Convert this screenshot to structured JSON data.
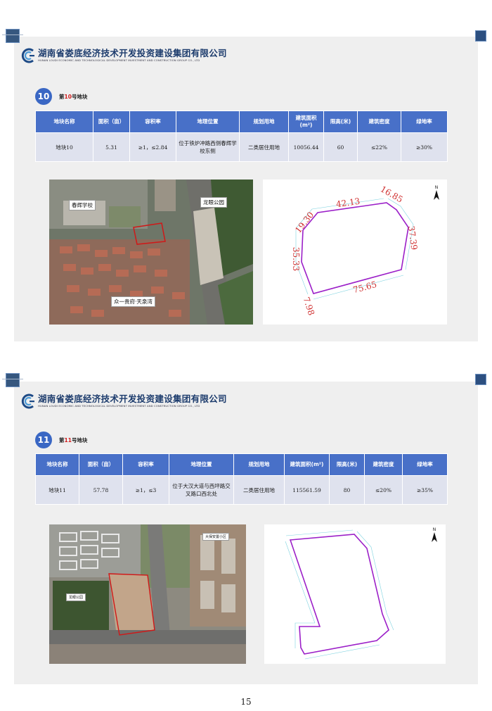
{
  "company": {
    "name_cn": "湖南省娄底经济技术开发投资建设集团有限公司",
    "name_en": "HUNAN LOUDI ECONOMIC AND TECHNOLOGICAL DEVELOPMENT INVESTMENT AND CONSTRUCTION GROUP CO., LTD"
  },
  "table_headers": {
    "name": "地块名称",
    "area": "面积（亩）",
    "far": "容积率",
    "location": "地理位置",
    "land_use": "规划用地",
    "floor_area": "建筑面积(m²)",
    "height": "限高(米)",
    "density": "建筑密度",
    "green": "绿地率"
  },
  "plots": [
    {
      "badge": "10",
      "heading_prefix": "第",
      "heading_num": "10",
      "heading_suffix": "号地块",
      "row": {
        "name": "地块10",
        "area": "5.31",
        "far": "≥1，≤2.84",
        "location": "位于铁炉冲路西侧春辉学校东侧",
        "land_use": "二类居住用地",
        "floor_area": "10056.44",
        "height": "60",
        "density": "≤22%",
        "green": "≥30%"
      },
      "map_labels": {
        "school": "春辉学校",
        "park": "龙眼公园",
        "estate": "众一贵府·天泉湾"
      },
      "diagram": {
        "north": "N",
        "dims": [
          "19.30",
          "42.13",
          "16.85",
          "37.39",
          "75.65",
          "7.98",
          "35.33"
        ]
      }
    },
    {
      "badge": "11",
      "heading_prefix": "第",
      "heading_num": "11",
      "heading_suffix": "号地块",
      "row": {
        "name": "地块11",
        "area": "57.78",
        "far": "≥1，≤3",
        "location": "位于大汉大道与西坪路交叉路口西北处",
        "land_use": "二类居住用地",
        "floor_area": "115561.59",
        "height": "80",
        "density": "≤20%",
        "green": "≥35%"
      },
      "map_labels": {
        "resettlement": "大保安置小区",
        "park": "龙眼公园"
      },
      "diagram": {
        "north": "N"
      }
    }
  ],
  "page_number": "15",
  "colors": {
    "header_blue": "#4870c8",
    "row_bg": "#dfe2ee",
    "badge_blue": "#3a67c4",
    "boundary_purple": "#9b1fc8",
    "boundary_red": "#d01818",
    "dim_red": "#d03030"
  }
}
